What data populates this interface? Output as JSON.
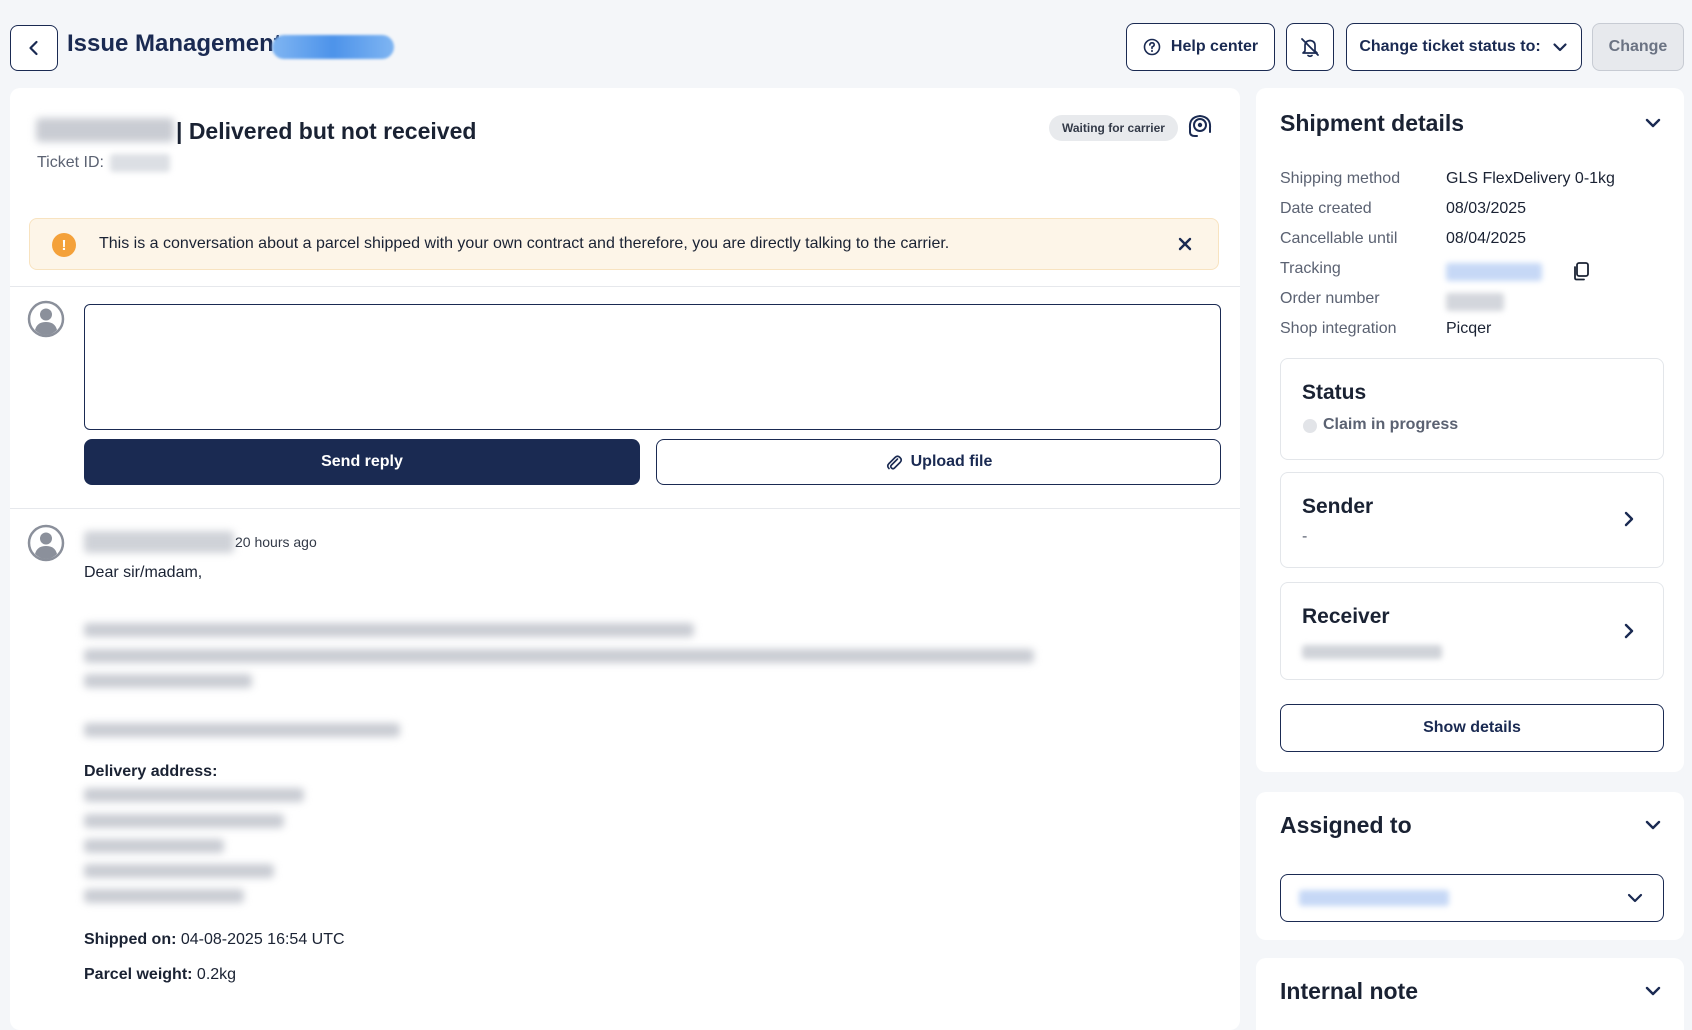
{
  "header": {
    "title": "Issue Management",
    "help_label": "Help center",
    "status_label": "Change ticket status to:",
    "change_label": "Change"
  },
  "ticket": {
    "title": "| Delivered but not received",
    "id_label": "Ticket ID:",
    "status_badge": "Waiting for carrier"
  },
  "alert": {
    "text": "This is a conversation about a parcel shipped with your own contract and therefore, you are directly talking to the carrier.",
    "icon": "!"
  },
  "reply": {
    "placeholder": "",
    "send_label": "Send reply",
    "upload_label": "Upload file"
  },
  "message": {
    "time": "20 hours ago",
    "greeting": "Dear sir/madam,",
    "delivery_address_label": "Delivery address:",
    "shipped_on_label": "Shipped on:",
    "shipped_on_value": " 04-08-2025 16:54 UTC",
    "weight_label": "Parcel weight:",
    "weight_value": " 0.2kg"
  },
  "shipment": {
    "title": "Shipment details",
    "rows": [
      {
        "key": "Shipping method",
        "value": "GLS FlexDelivery 0-1kg"
      },
      {
        "key": "Date created",
        "value": "08/03/2025"
      },
      {
        "key": "Cancellable until",
        "value": "08/04/2025"
      },
      {
        "key": "Tracking",
        "value": ""
      },
      {
        "key": "Order number",
        "value": ""
      },
      {
        "key": "Shop integration",
        "value": "Picqer"
      }
    ],
    "status_title": "Status",
    "status_value": "Claim in progress",
    "sender_title": "Sender",
    "sender_value": "-",
    "receiver_title": "Receiver",
    "show_details_label": "Show details"
  },
  "assigned": {
    "title": "Assigned to"
  },
  "internal_note": {
    "title": "Internal note"
  },
  "colors": {
    "primary": "#1a2a52",
    "alert_bg": "#fdf5e8",
    "alert_icon": "#f4a13a",
    "badge_blue": "#4d93ea"
  },
  "icons": {
    "back": "chevron-left-icon",
    "help": "question-circle-icon",
    "bell": "bell-off-icon",
    "chevron": "chevron-down-icon",
    "carrier": "carrier-headset-icon",
    "close": "close-icon",
    "attach": "paperclip-icon",
    "copy": "copy-icon",
    "avatar": "user-avatar-icon"
  }
}
